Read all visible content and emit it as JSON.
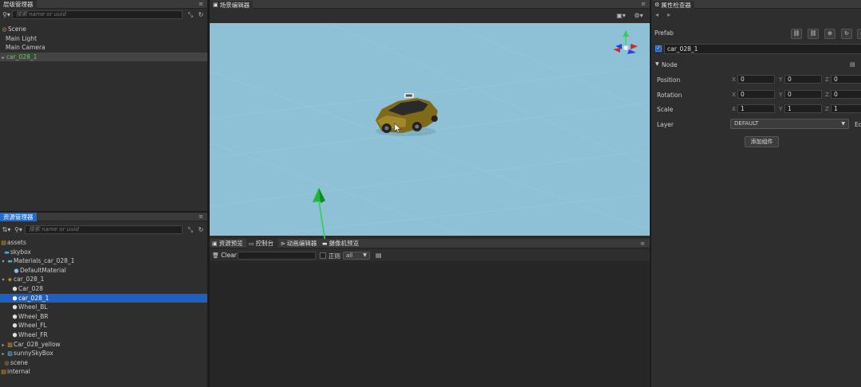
{
  "hierarchy": {
    "title": "层级管理器",
    "search_placeholder": "搜索 name or uuid",
    "items": [
      {
        "label": "Scene",
        "icon": "scene-icon"
      },
      {
        "label": "Main Light"
      },
      {
        "label": "Main Camera"
      },
      {
        "label": "car_028_1"
      }
    ]
  },
  "scene_editor": {
    "title": "场景编辑器"
  },
  "assets": {
    "title": "资源管理器",
    "search_placeholder": "搜索 name or uuid",
    "items": [
      {
        "label": "assets"
      },
      {
        "label": "skybox"
      },
      {
        "label": "Materials_car_028_1"
      },
      {
        "label": "DefaultMaterial"
      },
      {
        "label": "car_028_1"
      },
      {
        "label": "Car_028"
      },
      {
        "label": "car_028_1"
      },
      {
        "label": "Wheel_BL"
      },
      {
        "label": "Wheel_BR"
      },
      {
        "label": "Wheel_FL"
      },
      {
        "label": "Wheel_FR"
      },
      {
        "label": "Car_028_yellow"
      },
      {
        "label": "sunnySkyBox"
      },
      {
        "label": "scene"
      },
      {
        "label": "internal"
      }
    ]
  },
  "bottom": {
    "tabs": [
      "资源预览",
      "控制台",
      "动画编辑器",
      "摄像机预览"
    ],
    "clear_label": "Clear",
    "regex_label": "正则",
    "level_value": "all"
  },
  "inspector": {
    "title": "属性检查器",
    "prefab_label": "Prefab",
    "node_name": "car_028_1",
    "section_label": "Node",
    "position_label": "Position",
    "rotation_label": "Rotation",
    "scale_label": "Scale",
    "layer_label": "Layer",
    "layer_value": "DEFAULT",
    "layer_extra": "Ed",
    "x_label": "X",
    "y_label": "Y",
    "z_label": "Z",
    "position": {
      "x": "0",
      "y": "0",
      "z": "0"
    },
    "rotation": {
      "x": "0",
      "y": "0",
      "z": "0"
    },
    "scale": {
      "x": "1",
      "y": "1",
      "z": "1"
    },
    "add_component_label": "添加组件"
  },
  "colors": {
    "scene_bg": "#8ec0d6",
    "selection": "#1f5fbf",
    "accent_green": "#5ad35a"
  }
}
